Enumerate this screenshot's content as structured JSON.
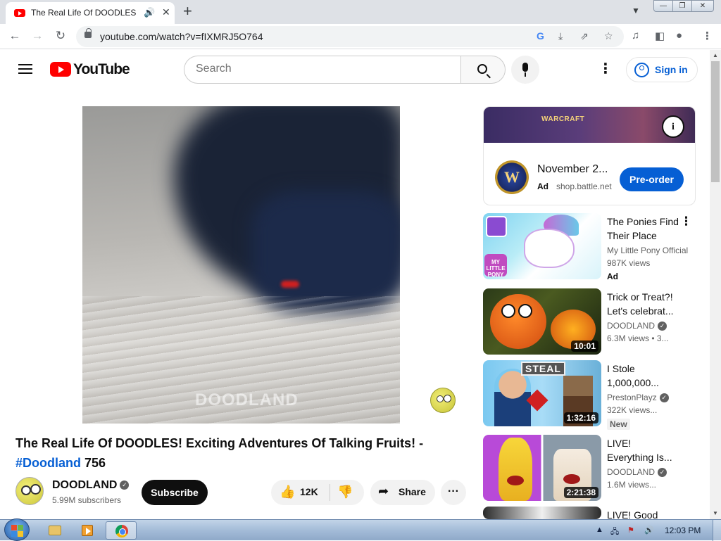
{
  "browser": {
    "tab_title": "The Real Life Of DOODLES! E",
    "url": "youtube.com/watch?v=fIXMRJ5O764",
    "icons": {
      "back": "arrow-left-icon",
      "forward": "arrow-right-icon",
      "reload": "reload-icon",
      "google": "google-lens-icon",
      "install": "install-icon",
      "share": "share-icon",
      "bookmark": "star-icon",
      "media": "media-control-icon",
      "sidepanel": "side-panel-icon",
      "profile": "profile-icon",
      "menu": "kebab-icon"
    }
  },
  "masthead": {
    "logo_text": "YouTube",
    "search_placeholder": "Search",
    "signin_label": "Sign in"
  },
  "player": {
    "watermark": "DOODLAND"
  },
  "video": {
    "title_main": "The Real Life Of DOODLES! Exciting Adventures Of Talking Fruits! - ",
    "hashtag": "#Doodland",
    "title_tail": " 756",
    "channel_name": "DOODLAND",
    "subscribers": "5.99M subscribers",
    "subscribe_label": "Subscribe",
    "likes": "12K",
    "share_label": "Share"
  },
  "ad": {
    "banner_text": "WARCRAFT",
    "logo_letter": "W",
    "title": "November 2...",
    "label": "Ad",
    "domain": "shop.battle.net",
    "button_label": "Pre-order",
    "info_glyph": "i"
  },
  "recommendations": [
    {
      "title": "The Ponies Find Their Place",
      "channel": "My Little Pony Official",
      "views": "987K views",
      "badge": "Ad",
      "duration": "",
      "verified": false,
      "thumb_text": "MY LITTLE PONY"
    },
    {
      "title": "Trick or Treat?! Let's celebrat...",
      "channel": "DOODLAND",
      "views": "6.3M views  •  3...",
      "badge": "",
      "duration": "10:01",
      "verified": true,
      "thumb_text": ""
    },
    {
      "title": "I Stole 1,000,000...",
      "channel": "PrestonPlayz",
      "views": "322K views...",
      "badge": "New",
      "duration": "1:32:16",
      "verified": true,
      "thumb_text": "STEAL"
    },
    {
      "title": "LIVE! Everything Is...",
      "channel": "DOODLAND",
      "views": "1.6M views...",
      "badge": "",
      "duration": "2:21:38",
      "verified": true,
      "thumb_text": ""
    },
    {
      "title": "LIVE! Good"
    }
  ],
  "taskbar": {
    "clock": "12:03 PM"
  }
}
